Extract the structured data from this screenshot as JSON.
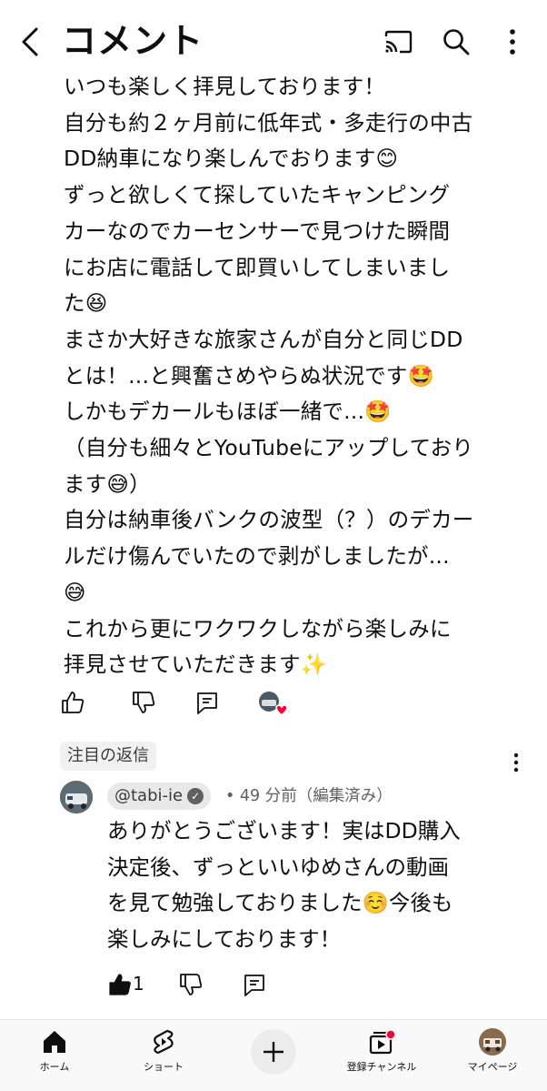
{
  "header": {
    "title": "コメント",
    "icons": [
      "back-arrow-icon",
      "cast-icon",
      "search-icon",
      "more-vertical-icon"
    ]
  },
  "comment": {
    "text": "いつも楽しく拝見しております！\n自分も約２ヶ月前に低年式・多走行の中古\nDD納車になり楽しんでおります😊\nずっと欲しくて探していたキャンピング\nカーなのでカーセンサーで見つけた瞬間\nにお店に電話して即買いしてしまいまし\nた😆\nまさか大好きな旅家さんが自分と同じDD\nとは！...と興奮さめやらぬ状況です🤩\nしかもデカールもほぼ一緒で...🤩\n（自分も細々とYouTubeにアップしており\nます😅）\n自分は納車後バンクの波型（？）のデカー\nルだけ傷んでいたので剥がしましたが...\n😅\nこれから更にワクワクしながら楽しみに\n拝見させていただきます✨",
    "actions": [
      "like-icon",
      "dislike-icon",
      "reply-icon"
    ],
    "creator_heart": "creator-heart-icon"
  },
  "pinned_reply": {
    "badge": "注目の返信",
    "channel": "@tabi-ie",
    "meta": "• 49 分前（編集済み）",
    "text": "ありがとうございます！実はDD購入\n決定後、ずっといいゆめさんの動画\nを見て勉強しておりました☺️今後も\n楽しみにしております！",
    "like_count": "1"
  },
  "bottom_nav": {
    "items": [
      {
        "label": "ホーム",
        "icon": "home-icon"
      },
      {
        "label": "ショート",
        "icon": "shorts-icon"
      },
      {
        "label": "",
        "icon": "create-plus-icon"
      },
      {
        "label": "登録チャンネル",
        "icon": "subscriptions-icon"
      },
      {
        "label": "マイページ",
        "icon": "profile-avatar"
      }
    ]
  },
  "colors": {
    "text": "#0f0f0f",
    "secondary": "#606060",
    "badge_bg": "#f1f1f1",
    "notification_red": "#ff0033"
  }
}
